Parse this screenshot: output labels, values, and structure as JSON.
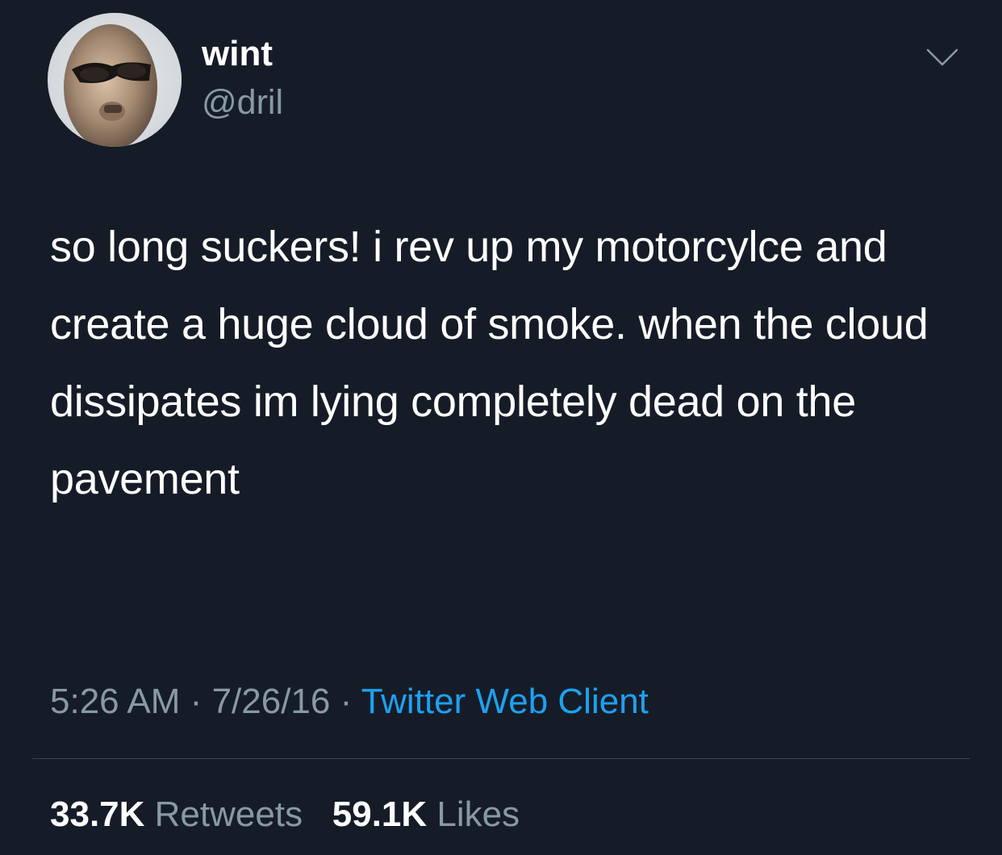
{
  "author": {
    "display_name": "wint",
    "handle": "@dril"
  },
  "icons": {
    "avatar": "profile-photo",
    "more": "chevron-down-icon"
  },
  "tweet": {
    "text": "so long suckers! i rev up my motorcylce and create a huge cloud of smoke. when the cloud dissipates im lying completely dead on the pavement"
  },
  "meta": {
    "time": "5:26 AM",
    "separator": "·",
    "date": "7/26/16",
    "source": "Twitter Web Client"
  },
  "stats": {
    "retweets_count": "33.7K",
    "retweets_label": "Retweets",
    "likes_count": "59.1K",
    "likes_label": "Likes"
  },
  "colors": {
    "background": "#161c27",
    "secondary_text": "#8899a6",
    "link": "#1da1f2",
    "divider": "#38444d"
  }
}
